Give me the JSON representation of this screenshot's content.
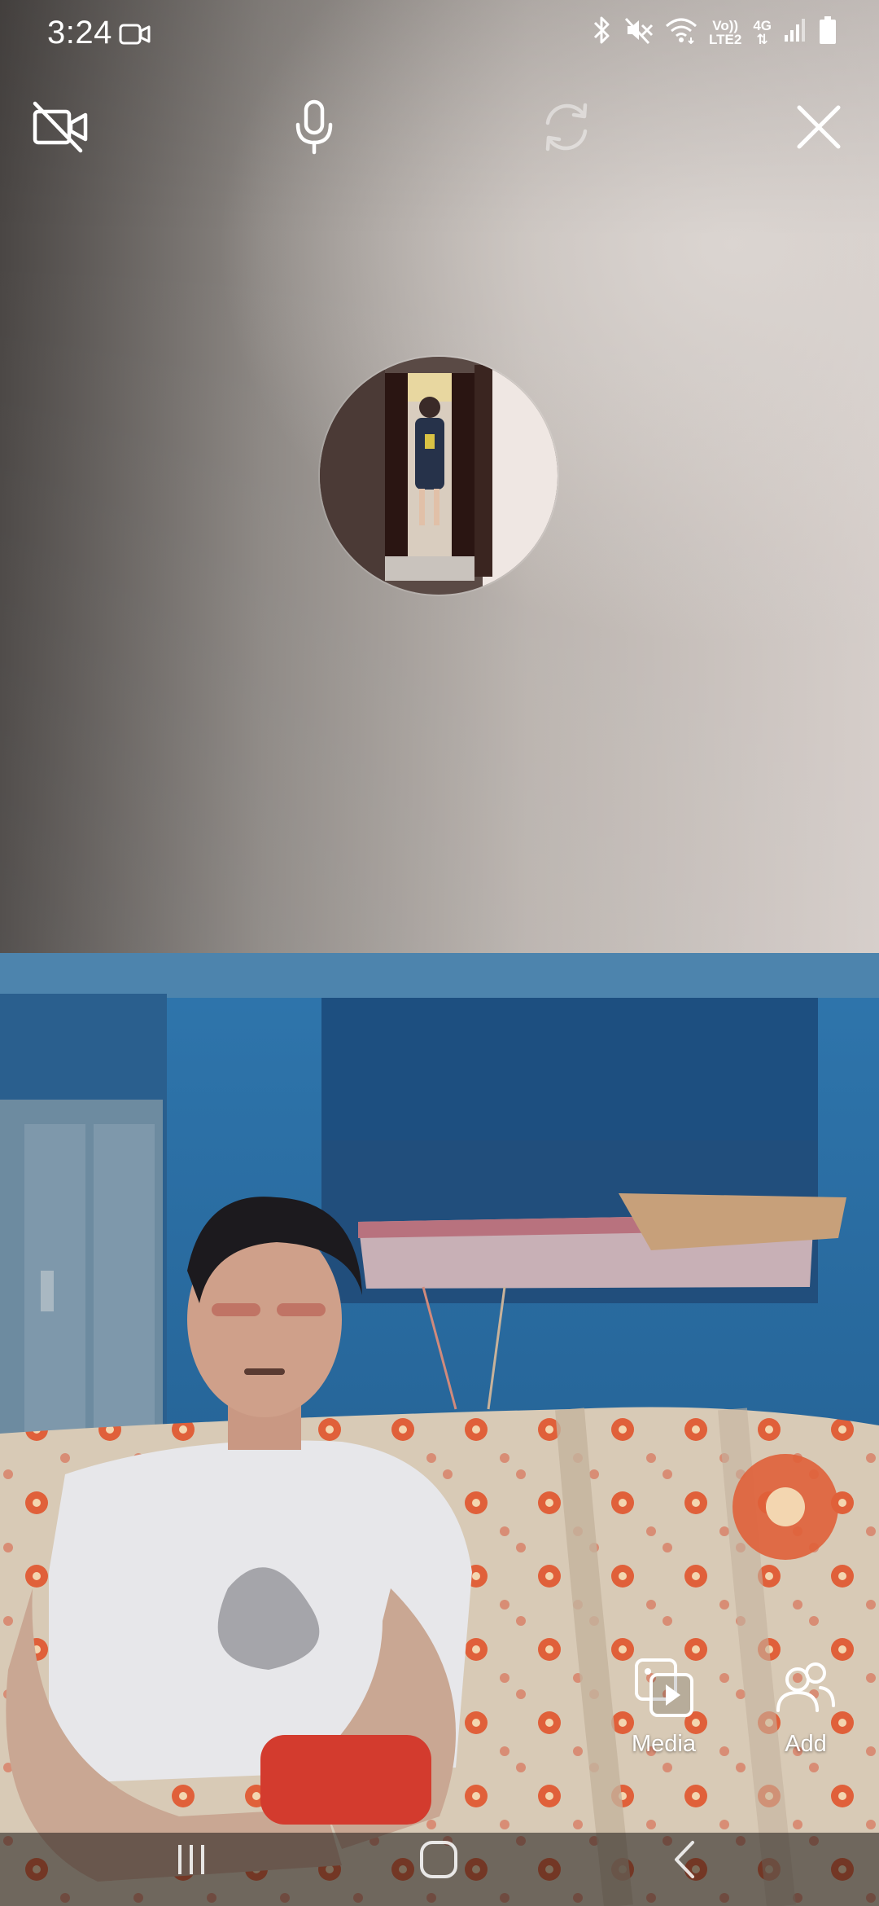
{
  "status_bar": {
    "time": "3:24",
    "volte": "Vo))",
    "lte": "LTE2",
    "network": "4G",
    "icons": [
      "video-recording-icon",
      "bluetooth-icon",
      "mute-icon",
      "wifi-icon",
      "signal-icon",
      "battery-icon"
    ]
  },
  "call_controls": {
    "buttons": [
      {
        "name": "camera-off-button",
        "icon": "video-off-icon"
      },
      {
        "name": "microphone-button",
        "icon": "microphone-icon"
      },
      {
        "name": "switch-camera-button",
        "icon": "camera-flip-icon",
        "disabled": true
      },
      {
        "name": "end-call-button",
        "icon": "close-icon"
      }
    ]
  },
  "remote": {
    "avatar": "profile-photo"
  },
  "actions": {
    "media_label": "Media",
    "add_label": "Add"
  },
  "nav": {
    "items": [
      "recent-apps",
      "home",
      "back"
    ]
  },
  "colors": {
    "wall_blue": "#2f6fa3",
    "bed_cream": "#d9cbb8",
    "flower_orange": "#e0603a"
  }
}
